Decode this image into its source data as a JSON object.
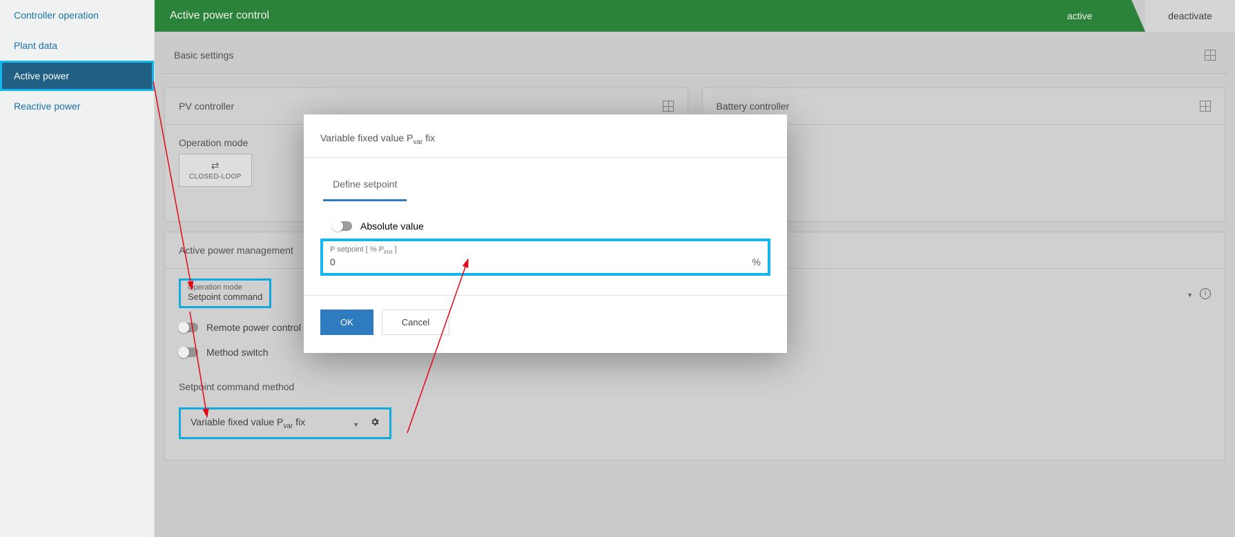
{
  "sidebar": {
    "items": [
      {
        "label": "Controller operation"
      },
      {
        "label": "Plant data"
      },
      {
        "label": "Active power"
      },
      {
        "label": "Reactive power"
      }
    ]
  },
  "header": {
    "title": "Active power control",
    "active_label": "active",
    "deactivate_label": "deactivate"
  },
  "basic_settings_label": "Basic settings",
  "pv": {
    "title": "PV controller",
    "operation_mode_label": "Operation mode",
    "closed_loop_label": "CLOSED-LOOP"
  },
  "battery": {
    "title": "Battery controller"
  },
  "apm": {
    "title": "Active power management",
    "operation_mode_label": "Operation mode",
    "operation_mode_value": "Setpoint command",
    "rpc_label": "Remote power control (RPC)",
    "method_switch_label": "Method switch",
    "setpoint_method_label": "Setpoint command method",
    "method_select_prefix": "Variable fixed value P",
    "method_select_sub": "var",
    "method_select_suffix": " fix"
  },
  "modal": {
    "title_prefix": "Variable fixed value P",
    "title_sub": "var",
    "title_suffix": " fix",
    "tab_label": "Define setpoint",
    "abs_label": "Absolute value",
    "input_label_prefix": "P setpoint [ % P",
    "input_label_sub": "inst",
    "input_label_suffix": " ]",
    "input_value": "0",
    "input_unit": "%",
    "ok": "OK",
    "cancel": "Cancel"
  }
}
